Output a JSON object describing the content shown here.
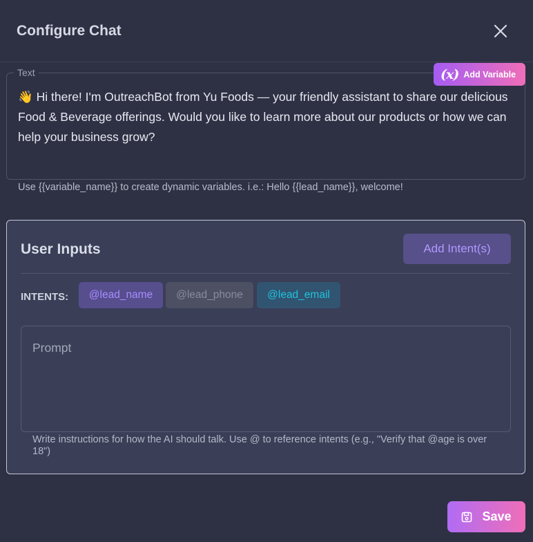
{
  "modal": {
    "title": "Configure Chat",
    "close_icon": "close-icon"
  },
  "text_section": {
    "legend": "Text",
    "content": "👋 Hi there! I'm OutreachBot from Yu Foods — your friendly assistant to share our delicious Food & Beverage offerings. Would you like to learn more about our products or how we can help your business grow?",
    "add_variable_icon": "(x)",
    "add_variable_label": "Add Variable",
    "help": "Use {{variable_name}} to create dynamic variables. i.e.: Hello {{lead_name}}, welcome!"
  },
  "user_inputs": {
    "title": "User Inputs",
    "add_intent_label": "Add Intent(s)",
    "intents_label": "INTENTS:",
    "intents": [
      {
        "label": "@lead_name",
        "color": "#a88cff"
      },
      {
        "label": "@lead_phone",
        "color": "#878b9c"
      },
      {
        "label": "@lead_email",
        "color": "#20c3dc"
      }
    ],
    "prompt_placeholder": "Prompt",
    "prompt_help": "Write instructions for how the AI should talk. Use @ to reference intents (e.g., \"Verify that @age is over 18\")"
  },
  "footer": {
    "save_label": "Save",
    "save_icon": "save-icon"
  },
  "colors": {
    "background": "#2e3144",
    "accent_gradient_start": "#a55cf3",
    "accent_gradient_end": "#f06eb8"
  }
}
